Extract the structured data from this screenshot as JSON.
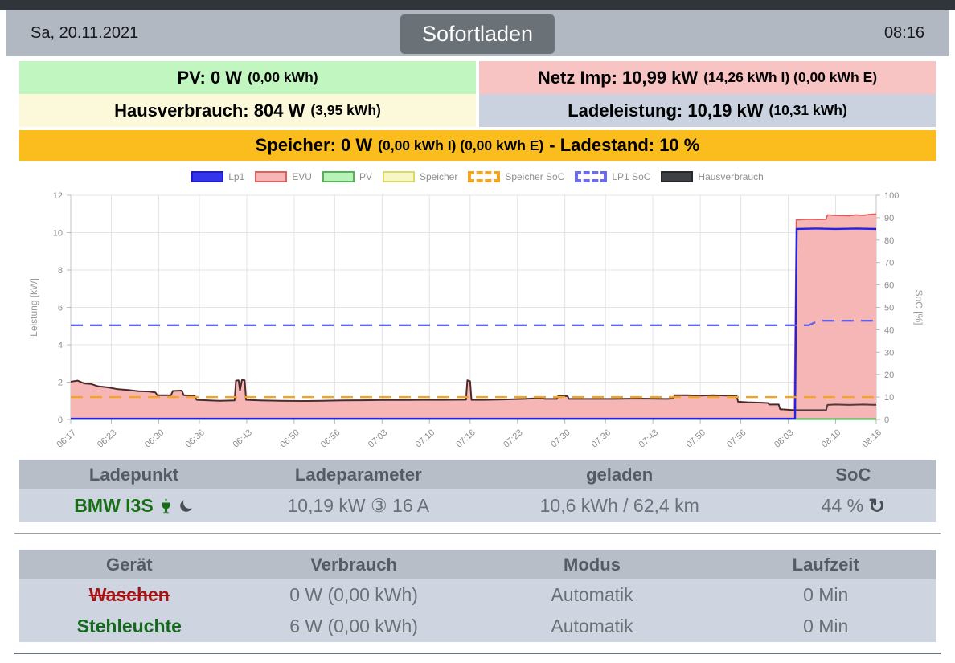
{
  "header": {
    "date": "Sa, 20.11.2021",
    "mode_button": "Sofortladen",
    "time": "08:16"
  },
  "status": {
    "pv": {
      "label": "PV: 0 W",
      "detail": "(0,00 kWh)"
    },
    "netz": {
      "label": "Netz Imp: 10,99 kW",
      "detail": "(14,26 kWh I) (0,00 kWh E)"
    },
    "haus": {
      "label": "Hausverbrauch: 804 W",
      "detail": "(3,95 kWh)"
    },
    "lade": {
      "label": "Ladeleistung: 10,19 kW",
      "detail": "(10,31 kWh)"
    },
    "speicher": {
      "label": "Speicher: 0 W",
      "detail": "(0,00 kWh I) (0,00 kWh E)",
      "suffix": "- Ladestand: 10 %"
    }
  },
  "chart_data": {
    "type": "area",
    "title": "",
    "ylabel_left": "Leistung [kW]",
    "ylabel_right": "SoC [%]",
    "ylim_left": [
      0,
      12
    ],
    "ylim_right": [
      0,
      100
    ],
    "grid": true,
    "legend_position": "top",
    "x_unit": "minutes after 06:17",
    "x_ticks": [
      {
        "label": "06:17",
        "min": 0
      },
      {
        "label": "06:23",
        "min": 6
      },
      {
        "label": "06:30",
        "min": 13
      },
      {
        "label": "06:36",
        "min": 19
      },
      {
        "label": "06:43",
        "min": 26
      },
      {
        "label": "06:50",
        "min": 33
      },
      {
        "label": "06:56",
        "min": 39
      },
      {
        "label": "07:03",
        "min": 46
      },
      {
        "label": "07:10",
        "min": 53
      },
      {
        "label": "07:16",
        "min": 59
      },
      {
        "label": "07:23",
        "min": 66
      },
      {
        "label": "07:30",
        "min": 73
      },
      {
        "label": "07:36",
        "min": 79
      },
      {
        "label": "07:43",
        "min": 86
      },
      {
        "label": "07:50",
        "min": 93
      },
      {
        "label": "07:56",
        "min": 99
      },
      {
        "label": "08:03",
        "min": 106
      },
      {
        "label": "08:10",
        "min": 113
      },
      {
        "label": "08:16",
        "min": 119
      }
    ],
    "legend": [
      {
        "name": "Lp1",
        "fill": "#3434ec",
        "border": "#1d1dcf",
        "style": "solid"
      },
      {
        "name": "EVU",
        "fill": "#f7b6b6",
        "border": "#e25e5e",
        "style": "solid"
      },
      {
        "name": "PV",
        "fill": "#b9f2b9",
        "border": "#52b552",
        "style": "solid"
      },
      {
        "name": "Speicher",
        "fill": "#f7f7c6",
        "border": "#d9d967",
        "style": "solid"
      },
      {
        "name": "Speicher SoC",
        "fill": "#ffffff",
        "border": "#f5a322",
        "style": "dashed"
      },
      {
        "name": "LP1 SoC",
        "fill": "#ffffff",
        "border": "#6a6af2",
        "style": "dashed"
      },
      {
        "name": "Hausverbrauch",
        "fill": "#3d4045",
        "border": "#26282b",
        "style": "solid"
      }
    ],
    "series": [
      {
        "name": "EVU",
        "axis": "left",
        "draw": "area",
        "color": "#e05c5c",
        "fill": "#f7b6b6",
        "width": 1.6,
        "points": [
          [
            0,
            2.02
          ],
          [
            1,
            2.08
          ],
          [
            2,
            1.93
          ],
          [
            3,
            1.9
          ],
          [
            4,
            1.78
          ],
          [
            5.5,
            1.72
          ],
          [
            7,
            1.62
          ],
          [
            8.5,
            1.58
          ],
          [
            10,
            1.52
          ],
          [
            11.5,
            1.5
          ],
          [
            12.5,
            1.45
          ],
          [
            12.8,
            1.3
          ],
          [
            14.8,
            1.3
          ],
          [
            15.1,
            1.53
          ],
          [
            16.4,
            1.55
          ],
          [
            16.7,
            1.3
          ],
          [
            18.3,
            1.28
          ],
          [
            18.6,
            1.05
          ],
          [
            20,
            1.03
          ],
          [
            22,
            1.0
          ],
          [
            24.2,
            1.02
          ],
          [
            24.4,
            2.08
          ],
          [
            24.8,
            2.1
          ],
          [
            25,
            1.55
          ],
          [
            25.3,
            2.12
          ],
          [
            25.7,
            2.1
          ],
          [
            25.9,
            1.05
          ],
          [
            28,
            1.02
          ],
          [
            31,
            1.0
          ],
          [
            34,
            0.99
          ],
          [
            37,
            1.0
          ],
          [
            40,
            1.02
          ],
          [
            43,
            1.03
          ],
          [
            46,
            1.04
          ],
          [
            49,
            1.04
          ],
          [
            52,
            1.05
          ],
          [
            55,
            1.05
          ],
          [
            58.4,
            1.06
          ],
          [
            58.6,
            2.1
          ],
          [
            59,
            2.05
          ],
          [
            59.2,
            1.05
          ],
          [
            61,
            1.05
          ],
          [
            64,
            1.07
          ],
          [
            67,
            1.1
          ],
          [
            69.7,
            1.15
          ],
          [
            70,
            1.1
          ],
          [
            71.8,
            1.1
          ],
          [
            72,
            1.25
          ],
          [
            73.4,
            1.25
          ],
          [
            73.6,
            1.1
          ],
          [
            76,
            1.1
          ],
          [
            80,
            1.1
          ],
          [
            84,
            1.12
          ],
          [
            88,
            1.1
          ],
          [
            89,
            1.12
          ],
          [
            89.2,
            1.3
          ],
          [
            91,
            1.3
          ],
          [
            93,
            1.28
          ],
          [
            95,
            1.3
          ],
          [
            97,
            1.28
          ],
          [
            98.4,
            1.25
          ],
          [
            98.6,
            0.95
          ],
          [
            100,
            0.92
          ],
          [
            102,
            0.9
          ],
          [
            103,
            0.88
          ],
          [
            103.2,
            0.8
          ],
          [
            104.6,
            0.8
          ],
          [
            104.8,
            0.55
          ],
          [
            106.9,
            0.5
          ],
          [
            107.2,
            10.68
          ],
          [
            109,
            10.72
          ],
          [
            110.5,
            10.7
          ],
          [
            111.6,
            10.72
          ],
          [
            111.8,
            10.95
          ],
          [
            113,
            10.92
          ],
          [
            115,
            10.9
          ],
          [
            116,
            10.95
          ],
          [
            117,
            10.92
          ],
          [
            118,
            10.97
          ],
          [
            119,
            11.0
          ]
        ]
      },
      {
        "name": "PV",
        "axis": "left",
        "draw": "line",
        "color": "#3fae3f",
        "width": 2,
        "points": [
          [
            0,
            0.02
          ],
          [
            119,
            0.02
          ]
        ]
      },
      {
        "name": "Hausverbrauch",
        "axis": "left",
        "draw": "line",
        "color": "rgba(35,25,25,0.78)",
        "width": 2,
        "follows": "EVU",
        "until": 107,
        "points": [
          [
            107.2,
            0.5
          ],
          [
            109,
            0.5
          ],
          [
            111.6,
            0.5
          ],
          [
            111.8,
            0.78
          ],
          [
            113,
            0.8
          ],
          [
            115,
            0.78
          ],
          [
            117,
            0.8
          ],
          [
            119,
            0.78
          ]
        ]
      },
      {
        "name": "Lp1",
        "axis": "left",
        "draw": "line",
        "color": "#2323e4",
        "width": 2.4,
        "points": [
          [
            0,
            0.04
          ],
          [
            107,
            0.04
          ],
          [
            107.25,
            10.2
          ],
          [
            110,
            10.22
          ],
          [
            113,
            10.2
          ],
          [
            116,
            10.22
          ],
          [
            119,
            10.2
          ]
        ]
      },
      {
        "name": "Speicher SoC",
        "axis": "right",
        "draw": "dashed",
        "color": "#f5a322",
        "width": 2.4,
        "points": [
          [
            0,
            10
          ],
          [
            119,
            10
          ]
        ]
      },
      {
        "name": "LP1 SoC",
        "axis": "right",
        "draw": "dashed",
        "color": "#6161ef",
        "width": 2.4,
        "points": [
          [
            0,
            42
          ],
          [
            109,
            42
          ],
          [
            110.5,
            44
          ],
          [
            119,
            44
          ]
        ]
      }
    ]
  },
  "ladepunkt_table": {
    "headers": [
      "Ladepunkt",
      "Ladeparameter",
      "geladen",
      "SoC"
    ],
    "row": {
      "name": "BMW I3S",
      "ladeparameter": "10,19 kW ③ 16 A",
      "geladen": "10,6 kWh / 62,4 km",
      "soc": "44 %",
      "refresh_icon": "↻"
    }
  },
  "geraete_table": {
    "headers": [
      "Gerät",
      "Verbrauch",
      "Modus",
      "Laufzeit"
    ],
    "rows": [
      {
        "device": "Waschen",
        "style": "dev-red",
        "verbrauch": "0 W (0,00 kWh)",
        "modus": "Automatik",
        "laufzeit": "0 Min"
      },
      {
        "device": "Stehleuchte",
        "style": "dev-green",
        "verbrauch": "6 W (0,00 kWh)",
        "modus": "Automatik",
        "laufzeit": "0 Min"
      }
    ]
  }
}
